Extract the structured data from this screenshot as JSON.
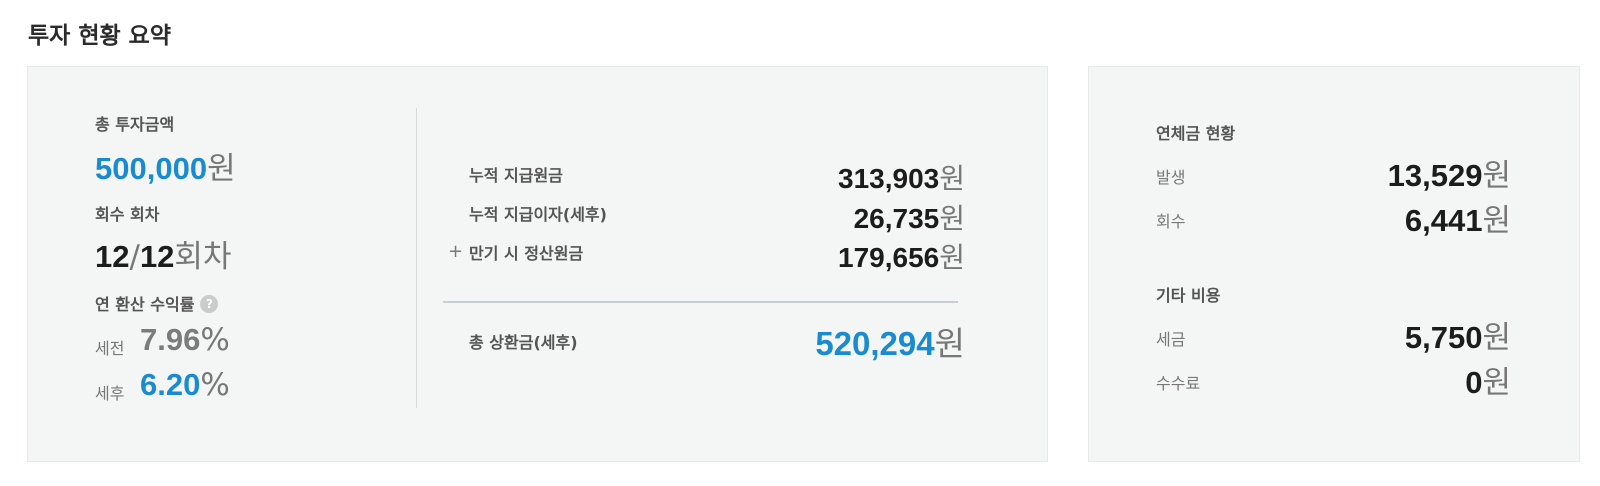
{
  "page_title": "투자 현황 요약",
  "summary": {
    "total_invest_label": "총 투자금액",
    "total_invest_value": "500,000",
    "won": "원",
    "rounds_label": "회수 회차",
    "rounds_current": "12",
    "rounds_sep": "/",
    "rounds_total": "12",
    "rounds_unit": "회차",
    "yield_label": "연 환산 수익률",
    "help_glyph": "?",
    "pre_tax_label": "세전",
    "pre_tax_value": "7.96",
    "post_tax_label": "세후",
    "post_tax_value": "6.20",
    "percent": "%"
  },
  "payments": {
    "rows": [
      {
        "prefix": "",
        "label": "누적 지급원금",
        "value": "313,903"
      },
      {
        "prefix": "",
        "label": "누적 지급이자(세후)",
        "value": "26,735"
      },
      {
        "prefix": "+",
        "label": "만기 시 정산원금",
        "value": "179,656"
      }
    ],
    "total_label": "총 상환금(세후)",
    "total_value": "520,294"
  },
  "overdue": {
    "section_label": "연체금 현황",
    "rows": [
      {
        "label": "발생",
        "value": "13,529"
      },
      {
        "label": "회수",
        "value": "6,441"
      }
    ]
  },
  "other_costs": {
    "section_label": "기타 비용",
    "rows": [
      {
        "label": "세금",
        "value": "5,750"
      },
      {
        "label": "수수료",
        "value": "0"
      }
    ]
  },
  "colors": {
    "accent_blue": "#1a8bd1",
    "panel_bg": "#f4f6f6"
  }
}
